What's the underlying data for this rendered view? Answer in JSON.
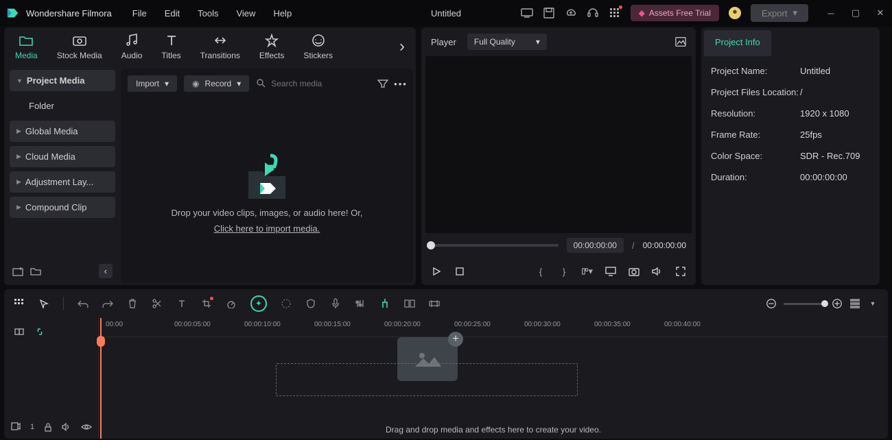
{
  "app": {
    "name": "Wondershare Filmora",
    "document": "Untitled"
  },
  "menu": [
    "File",
    "Edit",
    "Tools",
    "View",
    "Help"
  ],
  "assets_free_trial": "Assets Free Trial",
  "export_label": "Export",
  "categories": [
    {
      "name": "Media",
      "active": true
    },
    {
      "name": "Stock Media"
    },
    {
      "name": "Audio"
    },
    {
      "name": "Titles"
    },
    {
      "name": "Transitions"
    },
    {
      "name": "Effects"
    },
    {
      "name": "Stickers"
    }
  ],
  "sidebar": {
    "items": [
      "Project Media",
      "Folder",
      "Global Media",
      "Cloud Media",
      "Adjustment Lay...",
      "Compound Clip"
    ]
  },
  "media_toolbar": {
    "import": "Import",
    "record": "Record",
    "search_placeholder": "Search media"
  },
  "media_drop": {
    "line1": "Drop your video clips, images, or audio here! Or,",
    "link": "Click here to import media."
  },
  "player": {
    "label": "Player",
    "quality": "Full Quality",
    "time_current": "00:00:00:00",
    "time_sep": "/",
    "time_total": "00:00:00:00"
  },
  "project_info": {
    "tab": "Project Info",
    "rows": [
      {
        "label": "Project Name:",
        "value": "Untitled"
      },
      {
        "label": "Project Files Location:",
        "value": "/"
      },
      {
        "label": "Resolution:",
        "value": "1920 x 1080"
      },
      {
        "label": "Frame Rate:",
        "value": "25fps"
      },
      {
        "label": "Color Space:",
        "value": "SDR - Rec.709"
      },
      {
        "label": "Duration:",
        "value": "00:00:00:00"
      }
    ]
  },
  "ruler": [
    "00:00",
    "00:00:05:00",
    "00:00:10:00",
    "00:00:15:00",
    "00:00:20:00",
    "00:00:25:00",
    "00:00:30:00",
    "00:00:35:00",
    "00:00:40:00"
  ],
  "timeline_hint": "Drag and drop media and effects here to create your video.",
  "track_num": "1"
}
